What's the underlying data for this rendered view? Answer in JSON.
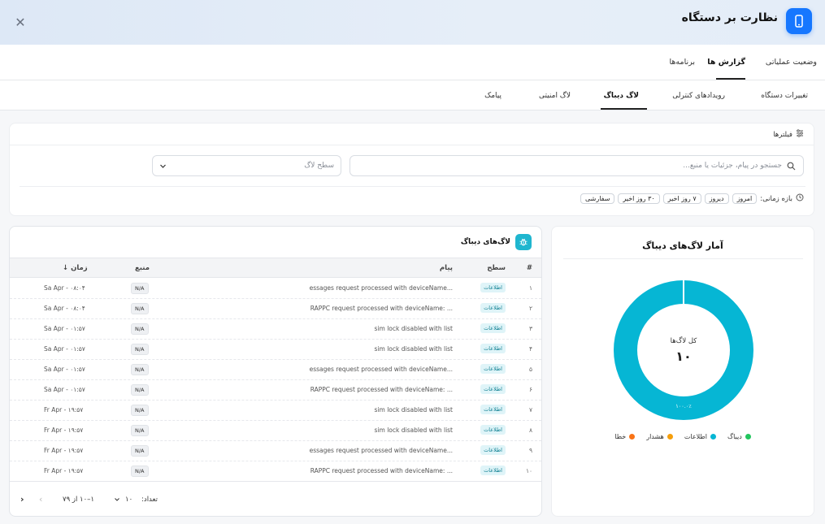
{
  "header": {
    "title": "نظارت بر دستگاه",
    "close_icon": "close-icon",
    "device_icon": "phone-icon",
    "accent": "#1677ff"
  },
  "tabs_top": [
    {
      "label": "وضعیت عملیاتی",
      "active": false
    },
    {
      "label": "گزارش ها",
      "active": true
    },
    {
      "label": "برنامه‌ها",
      "active": false
    }
  ],
  "tabs_sub": [
    {
      "label": "تغییرات دستگاه",
      "active": false
    },
    {
      "label": "رویدادهای کنترلی",
      "active": false
    },
    {
      "label": "لاگ دیباگ",
      "active": true
    },
    {
      "label": "لاگ امنیتی",
      "active": false
    },
    {
      "label": "پیامک",
      "active": false
    }
  ],
  "filters": {
    "title": "فیلترها",
    "search_placeholder": "جستجو در پیام، جزئیات یا منبع...",
    "level_placeholder": "سطح لاگ",
    "time_range_label": "بازه زمانی:",
    "chips": [
      "امروز",
      "دیروز",
      "۷ روز اخیر",
      "۳۰ روز اخیر",
      "سفارشی"
    ]
  },
  "logs": {
    "title": "لاگ‌های دیباگ",
    "columns": {
      "num": "#",
      "level": "سطح",
      "message": "پیام",
      "source": "منبع",
      "time": "زمان ↓"
    },
    "rows": [
      {
        "num": "۱",
        "level": "اطلاعات",
        "message": "essages request processed with deviceName...",
        "source": "N/A",
        "time": "Sa Apr - ۰۸:۰۴"
      },
      {
        "num": "۲",
        "level": "اطلاعات",
        "message": "RAPPC request processed with deviceName: ...",
        "source": "N/A",
        "time": "Sa Apr - ۰۸:۰۴"
      },
      {
        "num": "۳",
        "level": "اطلاعات",
        "message": "sim lock disabled with list",
        "source": "N/A",
        "time": "Sa Apr - ۰۱:۵۷"
      },
      {
        "num": "۴",
        "level": "اطلاعات",
        "message": "sim lock disabled with list",
        "source": "N/A",
        "time": "Sa Apr - ۰۱:۵۷"
      },
      {
        "num": "۵",
        "level": "اطلاعات",
        "message": "essages request processed with deviceName...",
        "source": "N/A",
        "time": "Sa Apr - ۰۱:۵۷"
      },
      {
        "num": "۶",
        "level": "اطلاعات",
        "message": "RAPPC request processed with deviceName: ...",
        "source": "N/A",
        "time": "Sa Apr - ۰۱:۵۷"
      },
      {
        "num": "۷",
        "level": "اطلاعات",
        "message": "sim lock disabled with list",
        "source": "N/A",
        "time": "Fr Apr - ۱۹:۵۷"
      },
      {
        "num": "۸",
        "level": "اطلاعات",
        "message": "sim lock disabled with list",
        "source": "N/A",
        "time": "Fr Apr - ۱۹:۵۷"
      },
      {
        "num": "۹",
        "level": "اطلاعات",
        "message": "essages request processed with deviceName...",
        "source": "N/A",
        "time": "Fr Apr - ۱۹:۵۷"
      },
      {
        "num": "۱۰",
        "level": "اطلاعات",
        "message": "RAPPC request processed with deviceName: ...",
        "source": "N/A",
        "time": "Fr Apr - ۱۹:۵۷"
      }
    ],
    "pager": {
      "count_label": "تعداد:",
      "page_size": "۱۰",
      "range": "۱–۱۰ از ۷۹"
    }
  },
  "stats": {
    "title": "آمار لاگ‌های دیباگ",
    "center_label": "کل لاگ‌ها",
    "center_value": "۱۰",
    "percent_label": "۱۰۰.۰٪",
    "legend": [
      {
        "label": "دیباگ",
        "color": "#22c55e"
      },
      {
        "label": "اطلاعات",
        "color": "#06b6d4"
      },
      {
        "label": "هشدار",
        "color": "#f59e0b"
      },
      {
        "label": "خطا",
        "color": "#f97316"
      }
    ]
  },
  "chart_data": {
    "type": "pie",
    "title": "آمار لاگ‌های دیباگ",
    "categories": [
      "دیباگ",
      "اطلاعات",
      "هشدار",
      "خطا"
    ],
    "values": [
      0,
      10,
      0,
      0
    ]
  }
}
